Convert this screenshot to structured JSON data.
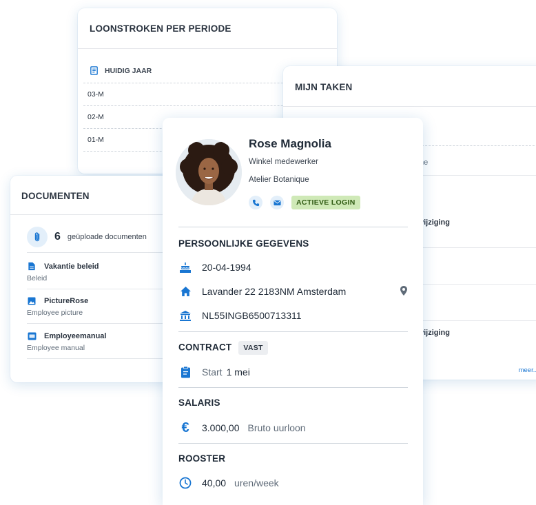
{
  "payslips": {
    "title": "LOONSTROKEN PER PERIODE",
    "group": "HUIDIG JAAR",
    "rows": [
      "03-M",
      "02-M",
      "01-M"
    ]
  },
  "tasks": {
    "title": "MIJN TAKEN",
    "partial_texts": [
      "ne",
      "vijziging",
      "vijziging"
    ],
    "more": "meer.."
  },
  "documents": {
    "title": "DOCUMENTEN",
    "count": "6",
    "count_label": "geüploade documenten",
    "items": [
      {
        "name": "Vakantie beleid",
        "sub": "Beleid",
        "icon": "document-icon"
      },
      {
        "name": "PictureRose",
        "sub": "Employee picture",
        "icon": "image-icon"
      },
      {
        "name": "Employeemanual",
        "sub": "Employee manual",
        "icon": "pdf-icon"
      }
    ]
  },
  "profile": {
    "name": "Rose Magnolia",
    "role": "Winkel medewerker",
    "org": "Atelier Botanique",
    "login_badge": "ACTIEVE LOGIN",
    "personal": {
      "title": "PERSOONLIJKE GEGEVENS",
      "birthdate": "20-04-1994",
      "address": "Lavander 22 2183NM Amsterdam",
      "iban": "NL55INGB6500713311"
    },
    "contract": {
      "title": "CONTRACT",
      "badge": "VAST",
      "start_label": "Start",
      "start_value": "1 mei"
    },
    "salary": {
      "title": "SALARIS",
      "amount": "3.000,00",
      "unit": "Bruto uurloon"
    },
    "schedule": {
      "title": "ROOSTER",
      "hours": "40,00",
      "unit": "uren/week"
    }
  },
  "colors": {
    "accent": "#1976d2",
    "login_badge_bg": "#cfe9b7",
    "icon_circle_bg": "#e3effa"
  }
}
